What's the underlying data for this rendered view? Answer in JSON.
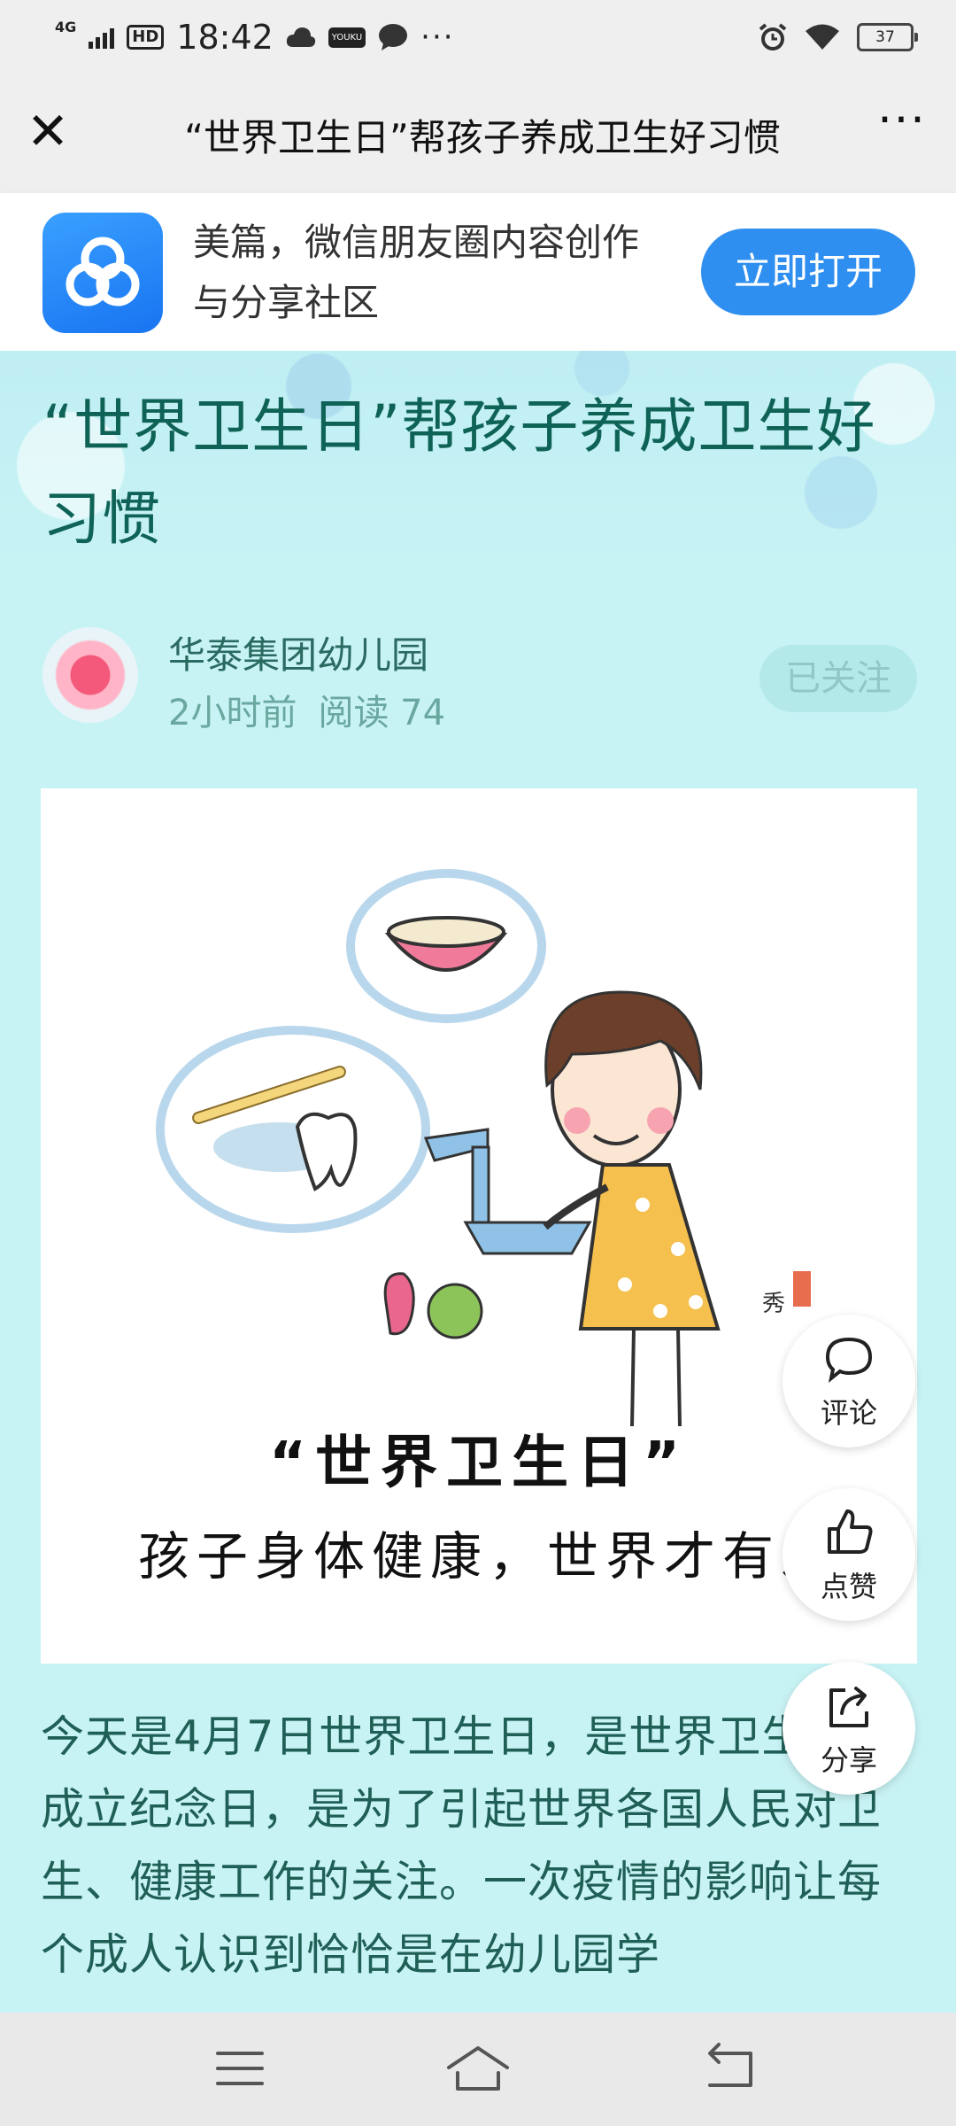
{
  "status_bar": {
    "network": "4G",
    "hd": "HD",
    "time": "18:42",
    "youku_label": "YOUKU",
    "more": "···",
    "battery": "37",
    "icons": [
      "signal-icon",
      "hd-icon",
      "cloud-icon",
      "youku-icon",
      "chat-bubble-icon",
      "more-dots-icon",
      "alarm-icon",
      "wifi-icon",
      "battery-icon"
    ]
  },
  "title_bar": {
    "close_icon": "close-icon",
    "title": "“世界卫生日”帮孩子养成卫生好习惯",
    "more_icon": "more-dots-icon"
  },
  "promo": {
    "app_icon": "meipian-logo-icon",
    "text": "美篇，微信朋友圈内容创作与分享社区",
    "open_button": "立即打开",
    "brand_color": "#2f8ff0"
  },
  "article": {
    "title": "“世界卫生日”帮孩子养成卫生好习惯",
    "author": "华泰集团幼儿园",
    "time_ago": "2小时前",
    "reads": "阅读 74",
    "follow_state": "已关注",
    "illustration": {
      "caption_title": "“世界卫生日”",
      "caption_sub": "孩子身体健康，世界才有未来"
    },
    "body": "今天是4月7日世界卫生日，是世界卫生组织成立纪念日，是为了引起世界各国人民对卫生、健康工作的关注。一次疫情的影响让每个成人认识到恰恰是在幼儿园学",
    "title_color": "#0f6356"
  },
  "floating_actions": {
    "comment": "评论",
    "like": "点赞",
    "share": "分享"
  },
  "nav_bar": {
    "icons": [
      "menu-icon",
      "home-icon",
      "back-icon"
    ]
  }
}
